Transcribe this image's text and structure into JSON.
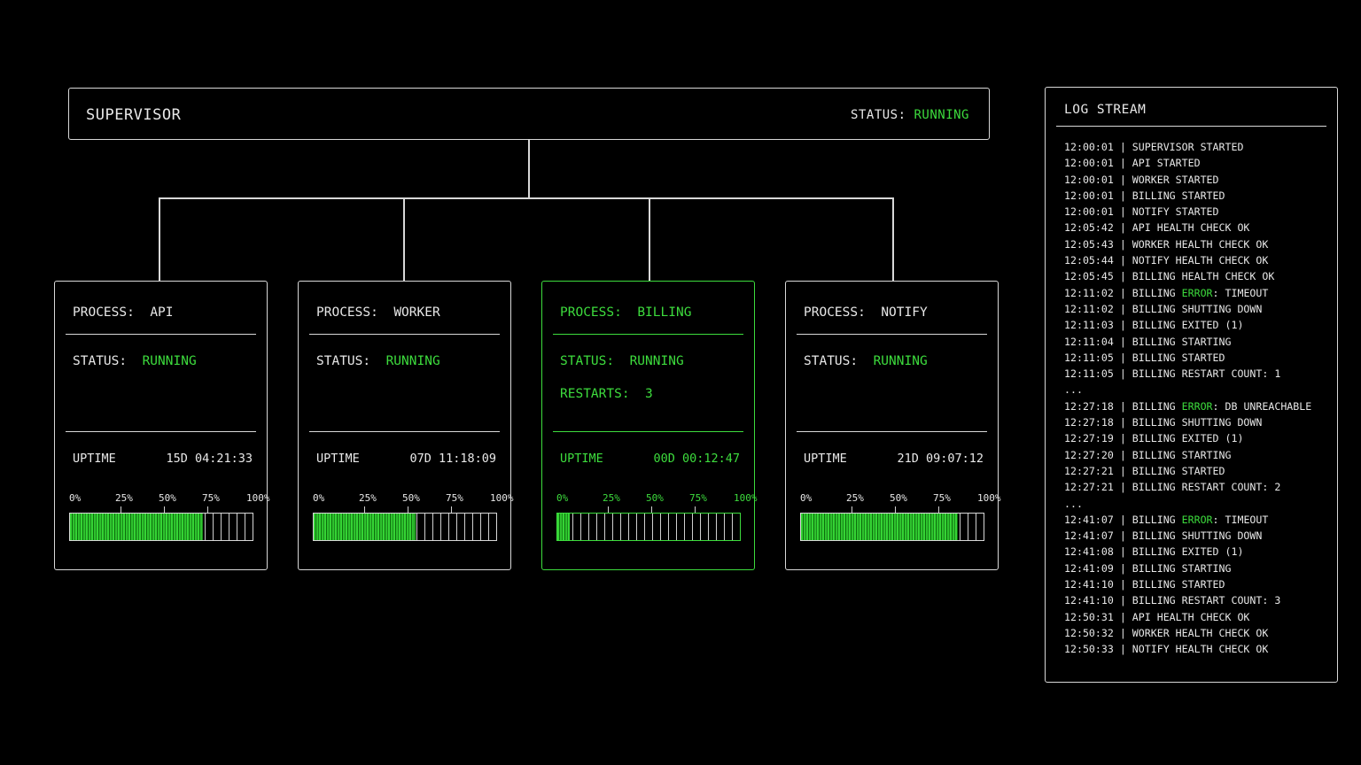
{
  "supervisor": {
    "title": "SUPERVISOR",
    "status_label": "STATUS:",
    "status_value": "RUNNING"
  },
  "processes": [
    {
      "title_label": "PROCESS:",
      "name": "API",
      "status_label": "STATUS:",
      "status_value": "RUNNING",
      "restarts_label": "",
      "restarts_value": "",
      "uptime_label": "UPTIME",
      "uptime_value": "15D 04:21:33",
      "progress": 0.73,
      "highlighted": false
    },
    {
      "title_label": "PROCESS:",
      "name": "WORKER",
      "status_label": "STATUS:",
      "status_value": "RUNNING",
      "restarts_label": "",
      "restarts_value": "",
      "uptime_label": "UPTIME",
      "uptime_value": "07D 11:18:09",
      "progress": 0.56,
      "highlighted": false
    },
    {
      "title_label": "PROCESS:",
      "name": "BILLING",
      "status_label": "STATUS:",
      "status_value": "RUNNING",
      "restarts_label": "RESTARTS:",
      "restarts_value": "3",
      "uptime_label": "UPTIME",
      "uptime_value": "00D 00:12:47",
      "progress": 0.07,
      "highlighted": true
    },
    {
      "title_label": "PROCESS:",
      "name": "NOTIFY",
      "status_label": "STATUS:",
      "status_value": "RUNNING",
      "restarts_label": "",
      "restarts_value": "",
      "uptime_label": "UPTIME",
      "uptime_value": "21D 09:07:12",
      "progress": 0.86,
      "highlighted": false
    }
  ],
  "progress_ticks": [
    "0%",
    "25%",
    "50%",
    "75%",
    "100%"
  ],
  "log": {
    "title": "LOG STREAM",
    "lines": [
      {
        "time": "12:00:01",
        "pre": "SUPERVISOR STARTED",
        "err": "",
        "post": ""
      },
      {
        "time": "12:00:01",
        "pre": "API STARTED",
        "err": "",
        "post": ""
      },
      {
        "time": "12:00:01",
        "pre": "WORKER STARTED",
        "err": "",
        "post": ""
      },
      {
        "time": "12:00:01",
        "pre": "BILLING STARTED",
        "err": "",
        "post": ""
      },
      {
        "time": "12:00:01",
        "pre": "NOTIFY STARTED",
        "err": "",
        "post": ""
      },
      {
        "time": "12:05:42",
        "pre": "API HEALTH CHECK OK",
        "err": "",
        "post": ""
      },
      {
        "time": "12:05:43",
        "pre": "WORKER HEALTH CHECK OK",
        "err": "",
        "post": ""
      },
      {
        "time": "12:05:44",
        "pre": "NOTIFY HEALTH CHECK OK",
        "err": "",
        "post": ""
      },
      {
        "time": "12:05:45",
        "pre": "BILLING HEALTH CHECK OK",
        "err": "",
        "post": ""
      },
      {
        "time": "12:11:02",
        "pre": "BILLING ",
        "err": "ERROR",
        "post": ": TIMEOUT"
      },
      {
        "time": "12:11:02",
        "pre": "BILLING SHUTTING DOWN",
        "err": "",
        "post": ""
      },
      {
        "time": "12:11:03",
        "pre": "BILLING EXITED (1)",
        "err": "",
        "post": ""
      },
      {
        "time": "12:11:04",
        "pre": "BILLING STARTING",
        "err": "",
        "post": ""
      },
      {
        "time": "12:11:05",
        "pre": "BILLING STARTED",
        "err": "",
        "post": ""
      },
      {
        "time": "12:11:05",
        "pre": "BILLING RESTART COUNT: 1",
        "err": "",
        "post": ""
      },
      {
        "ellipsis": "..."
      },
      {
        "time": "12:27:18",
        "pre": "BILLING ",
        "err": "ERROR",
        "post": ": DB UNREACHABLE"
      },
      {
        "time": "12:27:18",
        "pre": "BILLING SHUTTING DOWN",
        "err": "",
        "post": ""
      },
      {
        "time": "12:27:19",
        "pre": "BILLING EXITED (1)",
        "err": "",
        "post": ""
      },
      {
        "time": "12:27:20",
        "pre": "BILLING STARTING",
        "err": "",
        "post": ""
      },
      {
        "time": "12:27:21",
        "pre": "BILLING STARTED",
        "err": "",
        "post": ""
      },
      {
        "time": "12:27:21",
        "pre": "BILLING RESTART COUNT: 2",
        "err": "",
        "post": ""
      },
      {
        "ellipsis": "..."
      },
      {
        "time": "12:41:07",
        "pre": "BILLING ",
        "err": "ERROR",
        "post": ": TIMEOUT"
      },
      {
        "time": "12:41:07",
        "pre": "BILLING SHUTTING DOWN",
        "err": "",
        "post": ""
      },
      {
        "time": "12:41:08",
        "pre": "BILLING EXITED (1)",
        "err": "",
        "post": ""
      },
      {
        "time": "12:41:09",
        "pre": "BILLING STARTING",
        "err": "",
        "post": ""
      },
      {
        "time": "12:41:10",
        "pre": "BILLING STARTED",
        "err": "",
        "post": ""
      },
      {
        "time": "12:41:10",
        "pre": "BILLING RESTART COUNT: 3",
        "err": "",
        "post": ""
      },
      {
        "time": "12:50:31",
        "pre": "API HEALTH CHECK OK",
        "err": "",
        "post": ""
      },
      {
        "time": "12:50:32",
        "pre": "WORKER HEALTH CHECK OK",
        "err": "",
        "post": ""
      },
      {
        "time": "12:50:33",
        "pre": "NOTIFY HEALTH CHECK OK",
        "err": "",
        "post": ""
      }
    ]
  },
  "colors": {
    "accent": "#3ddc3d",
    "border": "#d8d8d8",
    "background": "#000000"
  }
}
